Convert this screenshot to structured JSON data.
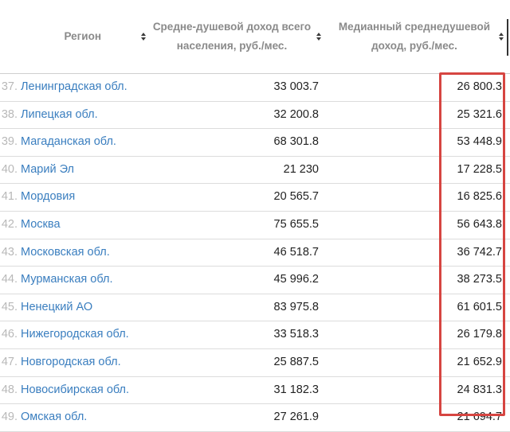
{
  "headers": {
    "region": "Регион",
    "avg_income": "Средне-душевой доход всего населения, руб./мес.",
    "median_income": "Медианный среднедушевой доход, руб./мес."
  },
  "rows": [
    {
      "index": "37.",
      "region": "Ленинградская обл.",
      "avg": "33 003.7",
      "median": "26 800.3"
    },
    {
      "index": "38.",
      "region": "Липецкая обл.",
      "avg": "32 200.8",
      "median": "25 321.6"
    },
    {
      "index": "39.",
      "region": "Магаданская обл.",
      "avg": "68 301.8",
      "median": "53 448.9"
    },
    {
      "index": "40.",
      "region": "Марий Эл",
      "avg": "21 230",
      "median": "17 228.5"
    },
    {
      "index": "41.",
      "region": "Мордовия",
      "avg": "20 565.7",
      "median": "16 825.6"
    },
    {
      "index": "42.",
      "region": "Москва",
      "avg": "75 655.5",
      "median": "56 643.8"
    },
    {
      "index": "43.",
      "region": "Московская обл.",
      "avg": "46 518.7",
      "median": "36 742.7"
    },
    {
      "index": "44.",
      "region": "Мурманская обл.",
      "avg": "45 996.2",
      "median": "38 273.5"
    },
    {
      "index": "45.",
      "region": "Ненецкий АО",
      "avg": "83 975.8",
      "median": "61 601.5"
    },
    {
      "index": "46.",
      "region": "Нижегородская обл.",
      "avg": "33 518.3",
      "median": "26 179.8"
    },
    {
      "index": "47.",
      "region": "Новгородская обл.",
      "avg": "25 887.5",
      "median": "21 652.9"
    },
    {
      "index": "48.",
      "region": "Новосибирская обл.",
      "avg": "31 182.3",
      "median": "24 831.3"
    },
    {
      "index": "49.",
      "region": "Омская обл.",
      "avg": "27 261.9",
      "median": "21 694.7"
    }
  ],
  "colors": {
    "link": "#3a7ebf",
    "highlight": "#d64541",
    "header_text": "#8a8a8a"
  },
  "icons": {
    "sort": "sort-icon"
  }
}
